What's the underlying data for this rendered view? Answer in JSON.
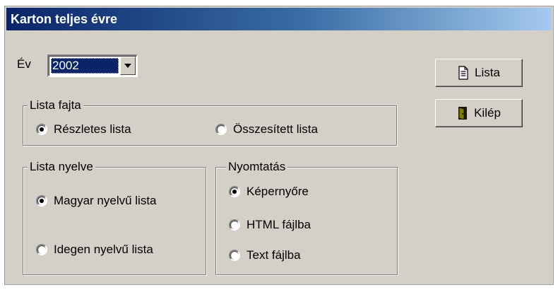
{
  "window": {
    "title": "Karton teljes évre"
  },
  "year": {
    "label": "Év",
    "value": "2002"
  },
  "list_type": {
    "legend": "Lista fajta",
    "options": [
      {
        "label": "Részletes lista",
        "selected": true
      },
      {
        "label": "Összesített lista",
        "selected": false
      }
    ]
  },
  "list_language": {
    "legend": "Lista nyelve",
    "options": [
      {
        "label": "Magyar nyelvű lista",
        "selected": true
      },
      {
        "label": "Idegen nyelvű lista",
        "selected": false
      }
    ]
  },
  "print": {
    "legend": "Nyomtatás",
    "options": [
      {
        "label": "Képernyőre",
        "selected": true
      },
      {
        "label": "HTML fájlba",
        "selected": false
      },
      {
        "label": "Text fájlba",
        "selected": false
      }
    ]
  },
  "buttons": {
    "list": "Lista",
    "exit": "Kilép"
  },
  "icons": {
    "list": "document-icon",
    "exit": "door-exit-icon"
  }
}
